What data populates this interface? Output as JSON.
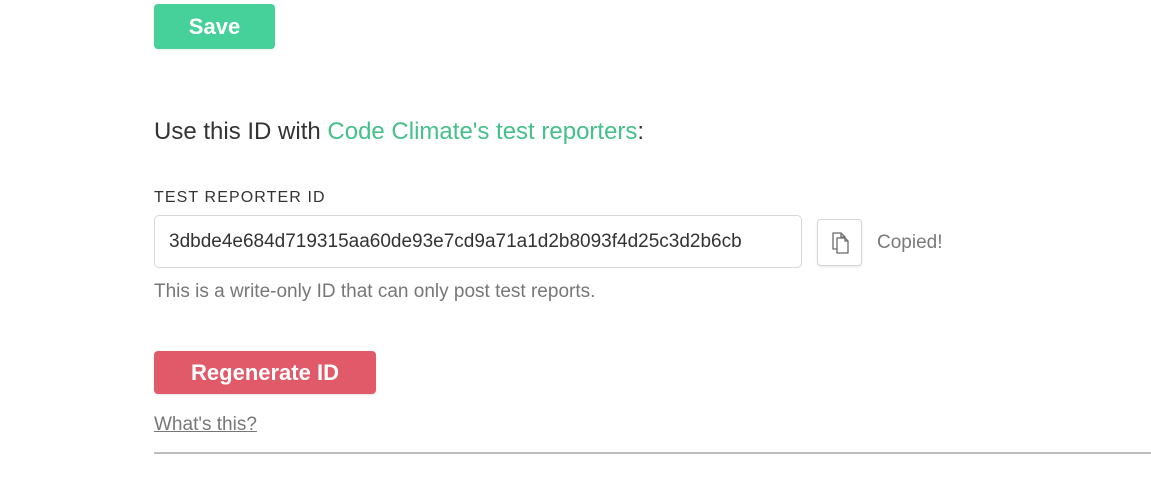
{
  "save_button": {
    "label": "Save"
  },
  "intro": {
    "prefix": "Use this ID with ",
    "link_text": "Code Climate's test reporters",
    "suffix": ":"
  },
  "test_reporter": {
    "label": "TEST REPORTER ID",
    "value": "3dbde4e684d719315aa60de93e7cd9a71a1d2b8093f4d25c3d2b6cb",
    "copy_icon": "copy-icon",
    "copied_status": "Copied!",
    "help_text": "This is a write-only ID that can only post test reports."
  },
  "regenerate_button": {
    "label": "Regenerate ID"
  },
  "whats_this": {
    "label": "What's this?"
  },
  "colors": {
    "save_green": "#45d199",
    "link_green": "#45c08a",
    "danger_red": "#e05a6a",
    "muted_text": "#777777"
  }
}
